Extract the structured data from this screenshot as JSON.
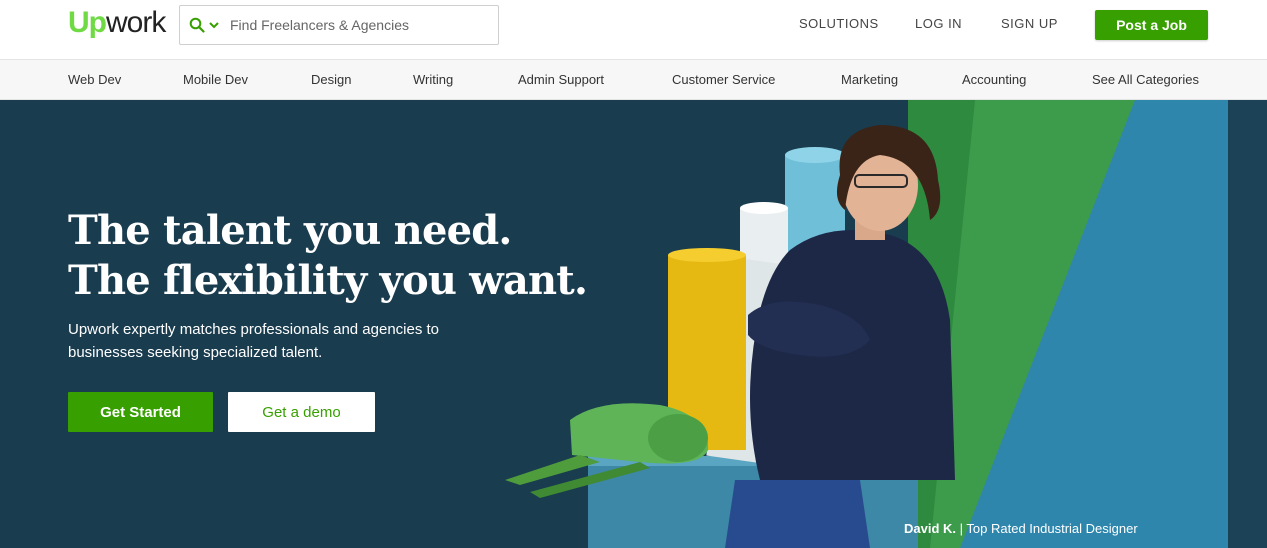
{
  "brand": {
    "logo_up": "Up",
    "logo_work": "work",
    "accent": "#37a000",
    "logo_green": "#6fda44"
  },
  "search": {
    "placeholder": "Find Freelancers & Agencies"
  },
  "topnav": {
    "solutions": "SOLUTIONS",
    "login": "LOG IN",
    "signup": "SIGN UP",
    "post_job": "Post a Job"
  },
  "categories": [
    "Web Dev",
    "Mobile Dev",
    "Design",
    "Writing",
    "Admin Support",
    "Customer Service",
    "Marketing",
    "Accounting",
    "See All Categories"
  ],
  "hero": {
    "headline_line1": "The talent you need.",
    "headline_line2": "The flexibility you want.",
    "subtext": "Upwork expertly matches professionals and agencies to businesses seeking specialized talent.",
    "get_started": "Get Started",
    "get_demo": "Get a demo",
    "caption_name": "David K.",
    "caption_separator": "|",
    "caption_title": "Top Rated Industrial Designer",
    "bg_color": "#193c4f"
  }
}
